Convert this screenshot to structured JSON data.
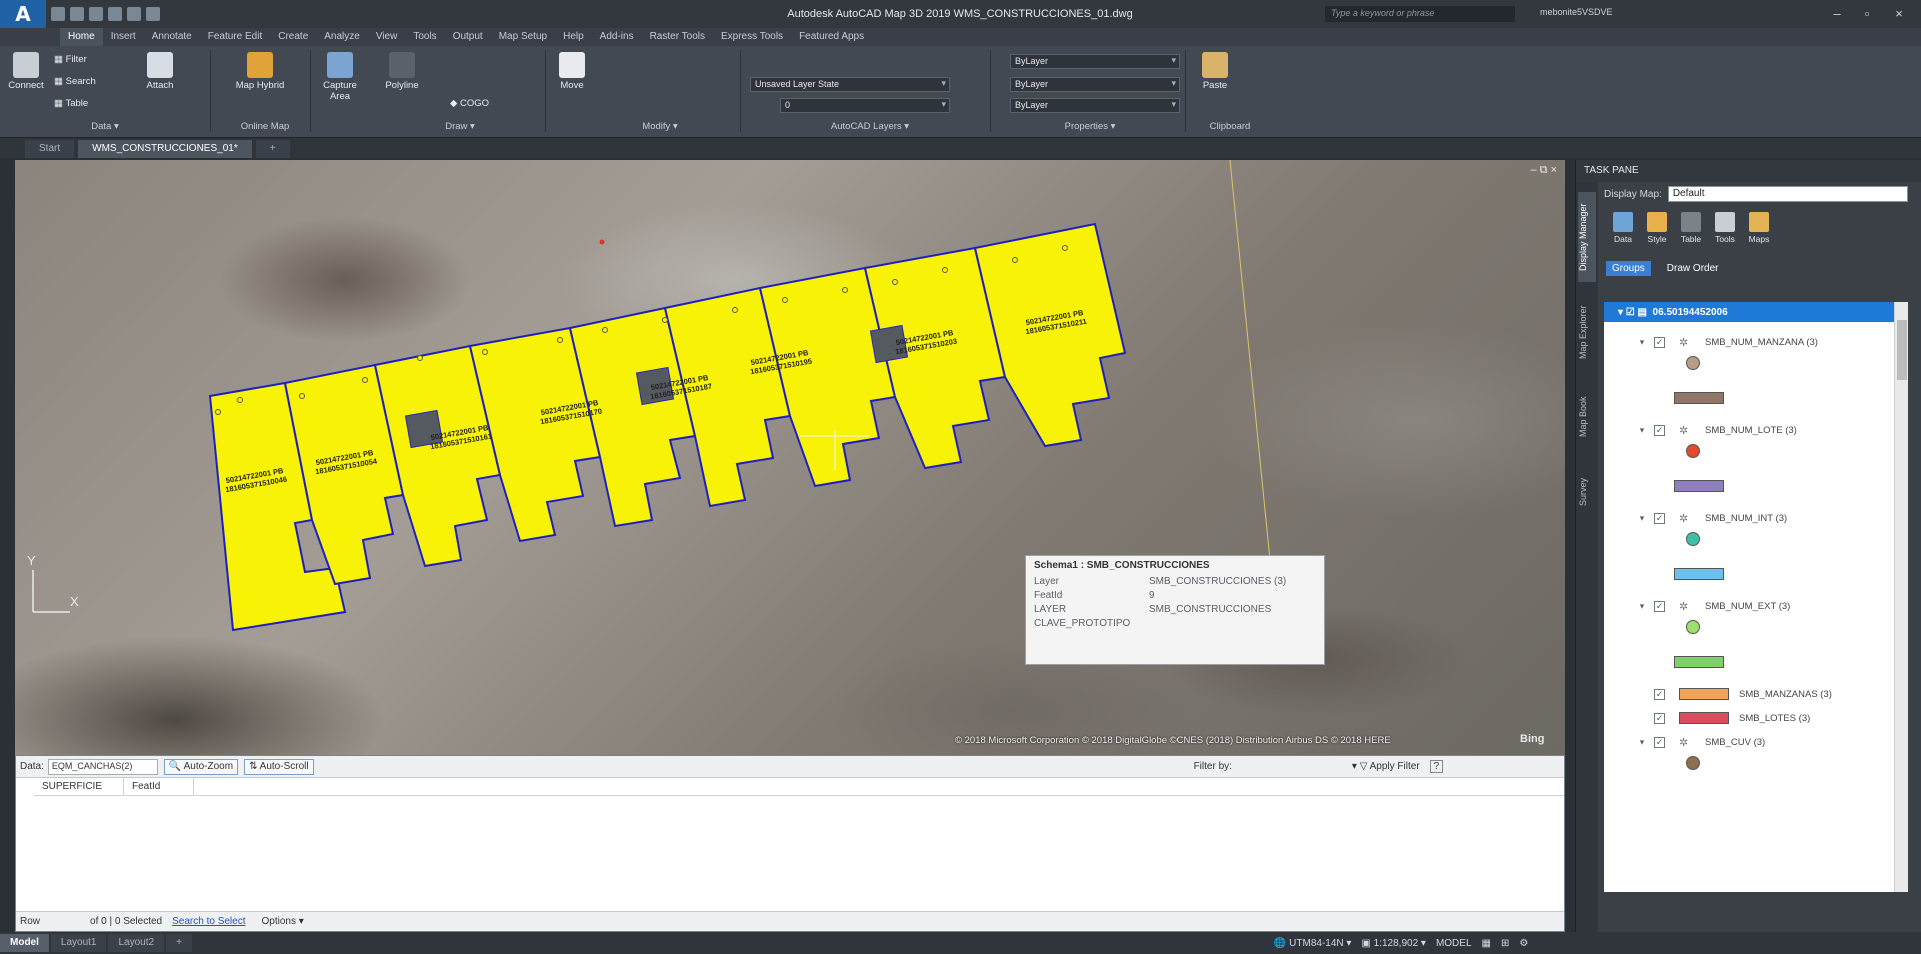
{
  "window": {
    "title": "Autodesk AutoCAD Map 3D 2019   WMS_CONSTRUCCIONES_01.dwg",
    "search_placeholder": "Type a keyword or phrase",
    "user": "mebonite5VSDVE"
  },
  "ribbon_tabs": [
    "Home",
    "Insert",
    "Annotate",
    "Feature Edit",
    "Create",
    "Analyze",
    "View",
    "Tools",
    "Output",
    "Map Setup",
    "Help",
    "Add-ins",
    "Raster Tools",
    "Express Tools",
    "Featured Apps"
  ],
  "ribbon": {
    "connect": "Connect",
    "filter": "Filter",
    "search": "Search",
    "table": "Table",
    "attach": "Attach",
    "map_hybrid": "Map Hybrid",
    "capture_area": "Capture Area",
    "polyline": "Polyline",
    "cogo": "COGO",
    "move": "Move",
    "layer_state": "Unsaved Layer State",
    "layer_current": "0",
    "bylayer_color": "ByLayer",
    "bylayer_linetype": "ByLayer",
    "bylayer_lineweight": "ByLayer",
    "paste": "Paste",
    "panels": [
      "Data ▾",
      "Online Map",
      "Draw ▾",
      "Modify ▾",
      "AutoCAD Layers ▾",
      "Properties ▾",
      "Clipboard"
    ]
  },
  "doc_tabs": [
    "Start",
    "WMS_CONSTRUCCIONES_01*"
  ],
  "viewport": {
    "controls": "– ⧉ ×",
    "copyright": "© 2018 Microsoft Corporation © 2018 DigitalGlobe ©CNES (2018) Distribution Airbus DS © 2018 HERE",
    "bing": "Bing",
    "axis_y": "Y",
    "axis_x": "X",
    "lot_labels": [
      [
        "50214722001 PB",
        "181605371510046"
      ],
      [
        "50214722001 PB",
        "181605371510054"
      ],
      [
        "50214722001 PB",
        "181605371510161"
      ],
      [
        "50214722001 PB",
        "181605371510170"
      ],
      [
        "50214722001 PB",
        "181605371510187"
      ],
      [
        "50214722001 PB",
        "181605371510195"
      ],
      [
        "50214722001 PB",
        "181605371510203"
      ],
      [
        "50214722001 PB",
        "181605371510211"
      ]
    ]
  },
  "tooltip": {
    "title": "Schema1 : SMB_CONSTRUCCIONES",
    "rows": [
      {
        "k": "Layer",
        "v": "SMB_CONSTRUCCIONES (3)"
      },
      {
        "k": "FeatId",
        "v": "9"
      },
      {
        "k": "LAYER",
        "v": "SMB_CONSTRUCCIONES"
      },
      {
        "k": "CLAVE_PROTOTIPO",
        "v": ""
      }
    ]
  },
  "datatable": {
    "data_label": "Data:",
    "data_source": "EQM_CANCHAS(2)",
    "auto_zoom": "Auto-Zoom",
    "auto_scroll": "Auto-Scroll",
    "filter_by": "Filter by:",
    "apply_filter": "Apply Filter",
    "columns": [
      "SUPERFICIE",
      "FeatId"
    ],
    "footer_row": "Row",
    "footer_count": "of 0  |  0 Selected",
    "footer_search": "Search to Select",
    "footer_options": "Options ▾"
  },
  "layout_tabs": [
    "Model",
    "Layout1",
    "Layout2",
    "+"
  ],
  "status": {
    "coord_system": "UTM84-14N ▾",
    "scale": "1:128,902 ▾",
    "model": "MODEL"
  },
  "taskpane": {
    "title": "TASK PANE",
    "display_map_label": "Display Map:",
    "display_map_value": "Default",
    "tools": [
      "Data",
      "Style",
      "Table",
      "Tools",
      "Maps"
    ],
    "groups": "Groups",
    "draw_order": "Draw Order",
    "vtabs": [
      "Display Manager",
      "Map Explorer",
      "Map Book",
      "Survey"
    ],
    "root_layer": "06.50194452006",
    "layers": [
      {
        "name": "SMB_NUM_MANZANA (3)",
        "sym": "#b79d86"
      },
      {
        "name": "SMB_NUM_LOTE (3)",
        "sym": "#e24a2c"
      },
      {
        "name": "SMB_NUM_INT (3)",
        "sym": "#3fc0a6"
      },
      {
        "name": "SMB_NUM_EXT (3)",
        "sym": "#9be06a"
      },
      {
        "name": "SMB_MANZANAS (3)",
        "sym": "#f0a45a"
      },
      {
        "name": "SMB_LOTES (3)",
        "sym": "#e04a5e"
      },
      {
        "name": "SMB_CUV (3)",
        "sym": "#8d6e4e"
      }
    ]
  }
}
